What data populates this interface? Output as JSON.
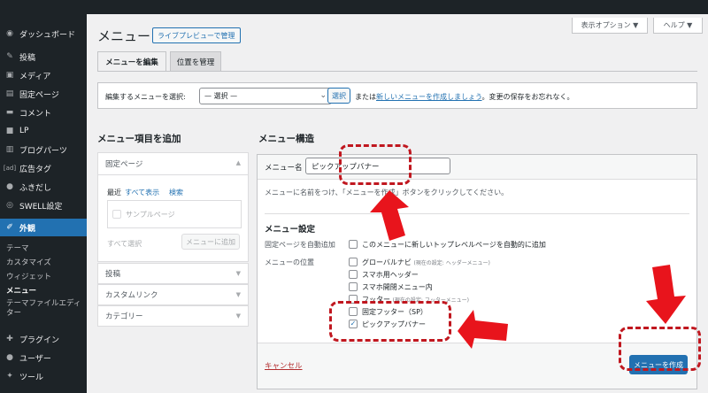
{
  "sidebar": {
    "items": [
      {
        "label": "ダッシュボード",
        "icon": "dashboard-icon"
      },
      {
        "label": "投稿",
        "icon": "pin-icon"
      },
      {
        "label": "メディア",
        "icon": "media-icon"
      },
      {
        "label": "固定ページ",
        "icon": "page-icon"
      },
      {
        "label": "コメント",
        "icon": "comment-icon"
      },
      {
        "label": "LP",
        "icon": "lp-icon"
      },
      {
        "label": "ブログパーツ",
        "icon": "blog-parts-icon"
      },
      {
        "label": "広告タグ",
        "icon": "ad-icon"
      },
      {
        "label": "ふきだし",
        "icon": "balloon-icon"
      },
      {
        "label": "SWELL設定",
        "icon": "swell-icon"
      },
      {
        "label": "外観",
        "icon": "appearance-icon"
      }
    ],
    "submenu": [
      "テーマ",
      "カスタマイズ",
      "ウィジェット",
      "メニュー",
      "テーマファイルエディター"
    ],
    "bottom": [
      {
        "label": "プラグイン",
        "icon": "plugin-icon"
      },
      {
        "label": "ユーザー",
        "icon": "user-icon"
      },
      {
        "label": "ツール",
        "icon": "tool-icon"
      }
    ]
  },
  "header": {
    "screen_options": "表示オプション ▼",
    "help": "ヘルプ ▼",
    "title": "メニュー",
    "live_preview": "ライブプレビューで管理"
  },
  "tabs": [
    "メニューを編集",
    "位置を管理"
  ],
  "select_bar": {
    "label": "編集するメニューを選択:",
    "value": "— 選択 —",
    "select_button": "選択",
    "text_prefix": "または",
    "link": "新しいメニューを作成しましょう",
    "text_suffix": "。変更の保存をお忘れなく。"
  },
  "add_items": {
    "heading": "メニュー項目を追加",
    "fixed_page": "固定ページ",
    "inner_tabs": [
      "最近",
      "すべて表示",
      "検索"
    ],
    "sample_page": "サンプルページ",
    "select_all": "すべて選択",
    "add_button": "メニューに追加",
    "sections": [
      "投稿",
      "カスタムリンク",
      "カテゴリー"
    ]
  },
  "structure": {
    "heading": "メニュー構造",
    "name_label": "メニュー名",
    "name_value": "ピックアップバナー",
    "instruction": "メニューに名前をつけ、「メニューを作成」ボタンをクリックしてください。",
    "settings_heading": "メニュー設定",
    "auto_add_label": "固定ページを自動追加",
    "auto_add_text": "このメニューに新しいトップレベルページを自動的に追加",
    "location_label": "メニューの位置",
    "locations": [
      {
        "name": "グローバルナビ",
        "note": "(現在の設定: ヘッダーメニュー)",
        "checked": false
      },
      {
        "name": "スマホ用ヘッダー",
        "note": "",
        "checked": false
      },
      {
        "name": "スマホ開閉メニュー内",
        "note": "",
        "checked": false
      },
      {
        "name": "フッター",
        "note": "(現在の設定: フッターメニュー)",
        "checked": false
      },
      {
        "name": "固定フッター（SP）",
        "note": "",
        "checked": false
      },
      {
        "name": "ピックアップバナー",
        "note": "",
        "checked": true
      }
    ],
    "cancel": "キャンセル",
    "create_button": "メニューを作成"
  },
  "colors": {
    "accent": "#2271b1",
    "annotation": "#e8141c",
    "sidebar": "#1d2327"
  }
}
